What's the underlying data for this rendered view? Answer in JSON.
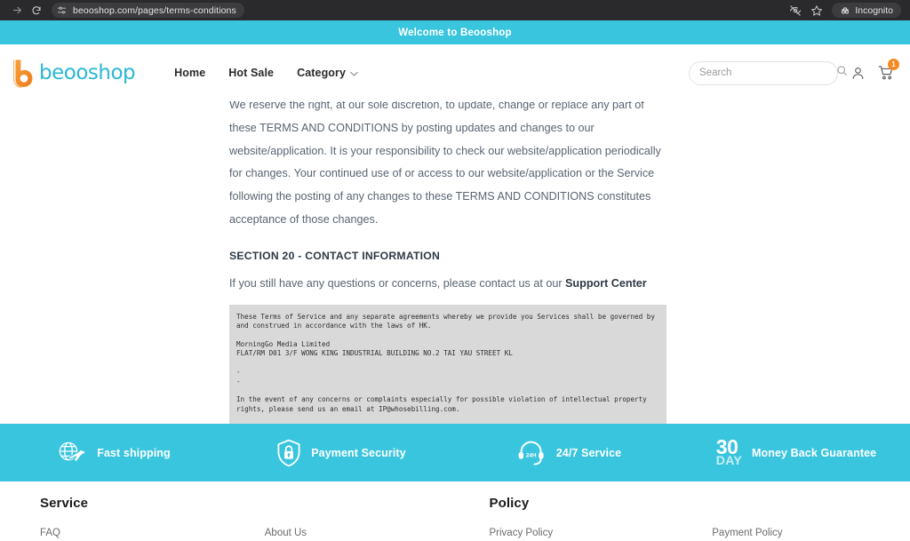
{
  "browser": {
    "forward_icon": "arrow-right-icon",
    "reload_icon": "reload-icon",
    "site_info_icon": "site-settings-icon",
    "url": "beooshop.com/pages/terms-conditions",
    "tracking_protection_icon": "eye-off-icon",
    "bookmark_icon": "star-icon",
    "incognito_icon": "incognito-icon",
    "incognito_label": "Incognito"
  },
  "announcement": {
    "text": "Welcome to Beooshop"
  },
  "header": {
    "logo_text": "beooshop",
    "logo_mark": "b-logo-icon",
    "nav": [
      {
        "label": "Home",
        "has_chevron": false
      },
      {
        "label": "Hot Sale",
        "has_chevron": false
      },
      {
        "label": "Category",
        "has_chevron": true
      }
    ],
    "search": {
      "placeholder": "Search",
      "value": "",
      "icon": "search-icon"
    },
    "account_icon": "user-icon",
    "cart_icon": "cart-icon",
    "cart_count": "1",
    "chevron_icon": "chevron-down-icon"
  },
  "main": {
    "paragraph_1": "We reserve the right, at our sole discretion, to update, change or replace any part of these TERMS AND CONDITIONS by posting updates and changes to our website/application. It is your responsibility to check our website/application periodically for changes. Your continued use of or access to our website/application or the Service following the posting of any changes to these TERMS AND CONDITIONS constitutes acceptance of those changes.",
    "section_heading": "SECTION 20 - CONTACT INFORMATION",
    "contact_prefix": "If you still have any questions or concerns, please contact us at our ",
    "contact_link": "Support Center",
    "code_block": "These Terms of Service and any separate agreements whereby we provide you Services shall be governed by and construed in accordance with the laws of HK.\n\nMorningGo Media Limited\nFLAT/RM D01 3/F WONG KING INDUSTRIAL BUILDING NO.2 TAI YAU STREET KL\n\n-\n-\n\nIn the event of any concerns or complaints especially for possible violation of intellectual property rights, please send us an email at IP@whosebilling.com."
  },
  "features": [
    {
      "label": "Fast shipping",
      "icon": "globe-plane-icon"
    },
    {
      "label": "Payment Security",
      "icon": "shield-lock-icon"
    },
    {
      "label": "24/7 Service",
      "icon": "headset-24h-icon",
      "icon_text": "24H"
    },
    {
      "label": "Money Back Guarantee",
      "icon": "thirty-day-icon",
      "icon_number": "30",
      "icon_unit": "DAY"
    }
  ],
  "footer": {
    "columns": [
      {
        "title": "Service",
        "link": "FAQ"
      },
      {
        "title": "",
        "link": "About Us"
      },
      {
        "title": "Policy",
        "link": "Privacy Policy"
      },
      {
        "title": "",
        "link": "Payment Policy"
      }
    ]
  },
  "colors": {
    "brand_teal": "#3ac5de",
    "logo_cyan": "#2bb8d4",
    "accent_orange": "#f5891f",
    "code_bg": "#d9d9d9",
    "chrome_bg": "#2a2a2c"
  }
}
